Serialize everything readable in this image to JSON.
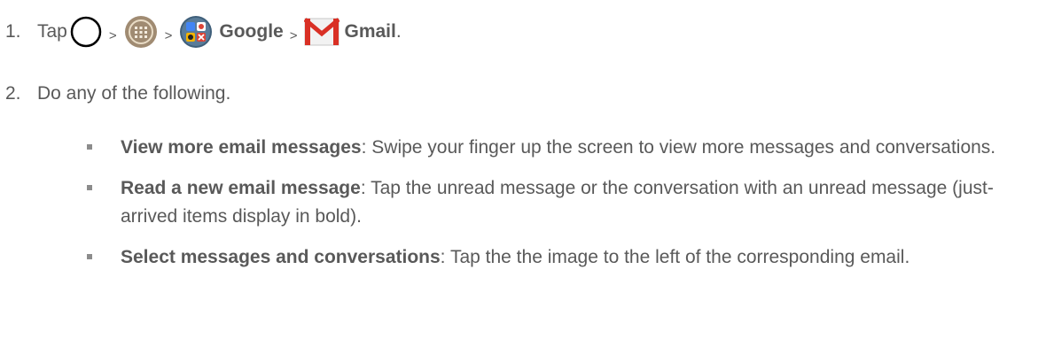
{
  "steps": [
    {
      "number": "1.",
      "segments": {
        "tap": "Tap",
        "home_icon": "home-circle-icon",
        "sep1": ">",
        "apps_icon": "apps-grid-icon",
        "sep2": ">",
        "google_icon": "google-folder-icon",
        "google_label": "Google",
        "sep3": ">",
        "gmail_icon": "gmail-envelope-icon",
        "gmail_label": "Gmail",
        "end": "."
      }
    },
    {
      "number": "2.",
      "text": "Do any of the following."
    }
  ],
  "bullets": [
    {
      "term": "View more email messages",
      "desc": ": Swipe your finger up the screen to view more messages and conversations."
    },
    {
      "term": "Read a new email message",
      "desc": ": Tap the unread message or the conversation with an unread message (just-arrived items display in bold)."
    },
    {
      "term": "Select messages and conversations",
      "desc": ": Tap the the image to the left of the corresponding email."
    }
  ],
  "colors": {
    "text": "#595959",
    "bullet": "#8c8c8c",
    "gmail_red": "#d93025"
  }
}
